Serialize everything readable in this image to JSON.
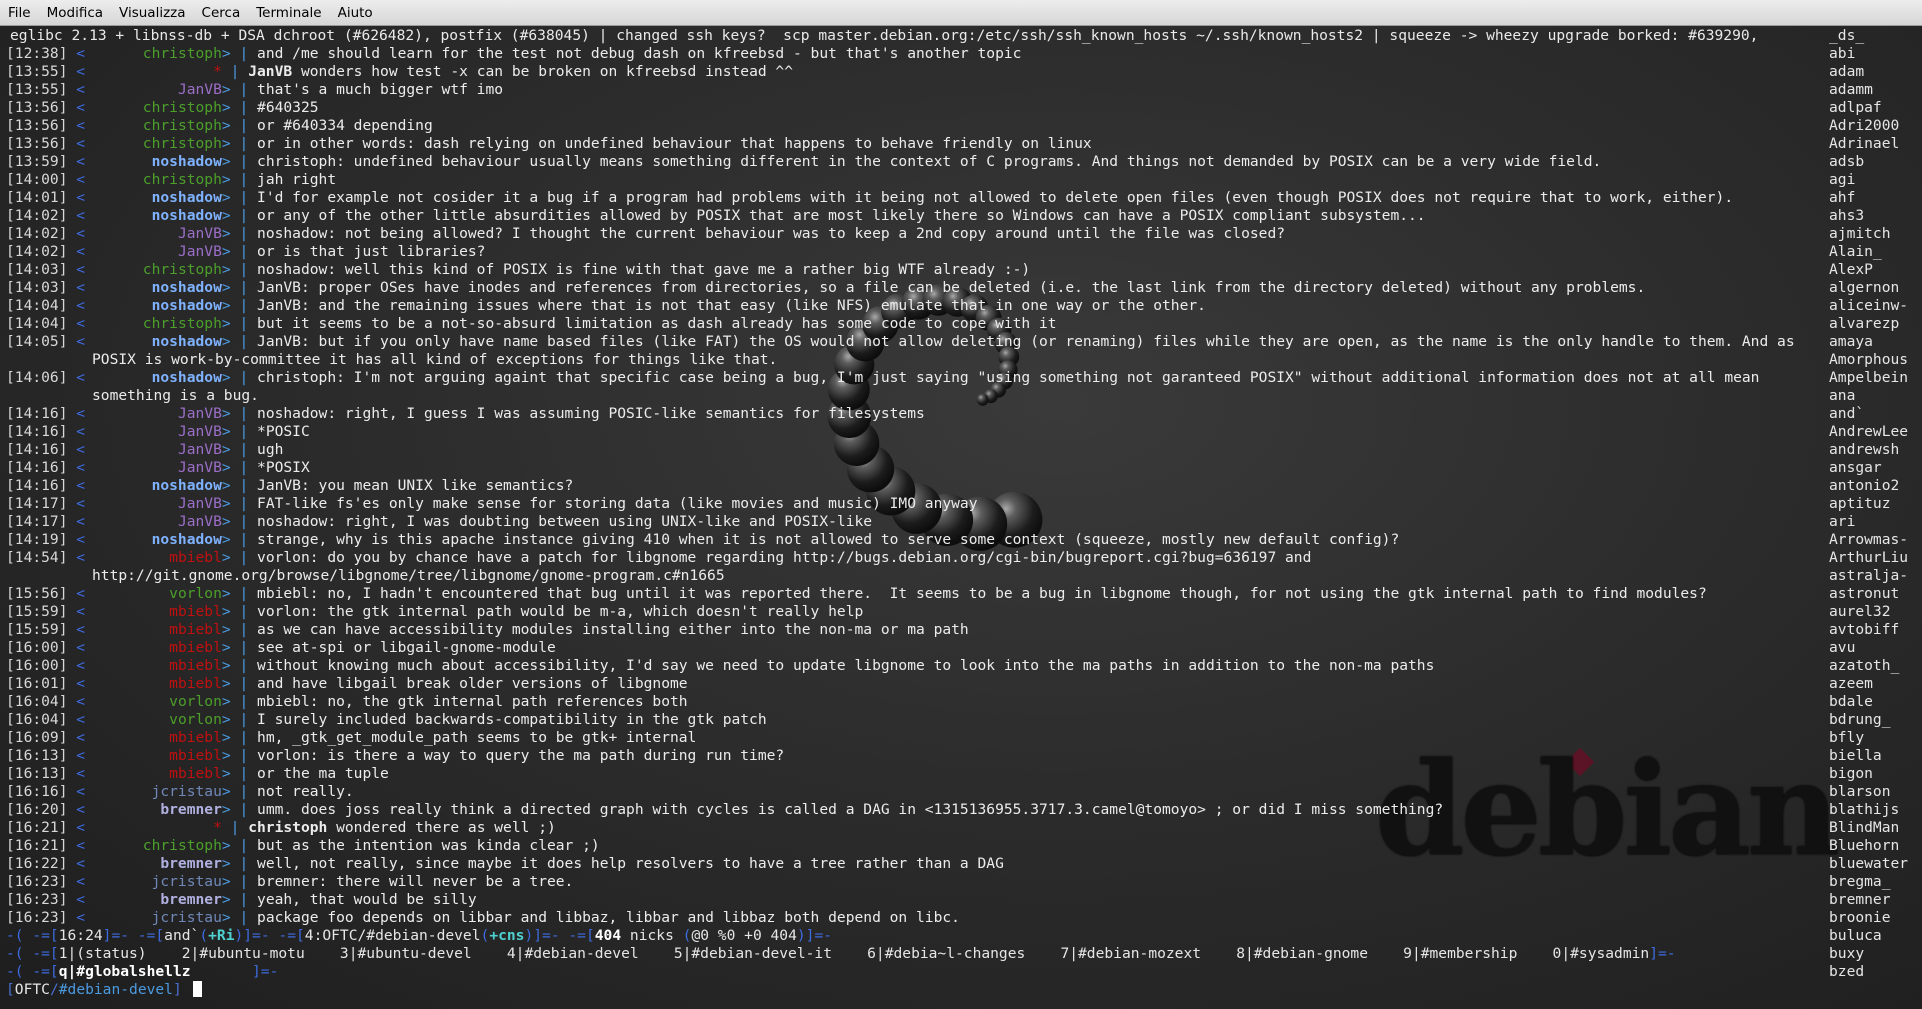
{
  "menu": [
    "File",
    "Modifica",
    "Visualizza",
    "Cerca",
    "Terminale",
    "Aiuto"
  ],
  "topic": "eglibc 2.13 + libnss-db + DSA dchroot (#626482), postfix (#638045) | changed ssh keys?  scp master.debian.org:/etc/ssh/ssh_known_hosts ~/.ssh/known_hosts2 | squeeze -> wheezy upgrade borked: #639290,",
  "logo_text": "debian",
  "messages": [
    {
      "ts": "[12:38]",
      "nick": "christoph",
      "cls": "c-christoph",
      "text": "and /me should learn for the test not debug dash on kfreebsd - but that's another topic"
    },
    {
      "ts": "[13:55]",
      "nick": "*",
      "cls": "c-star",
      "action": true,
      "actor": "JanVB",
      "text": "wonders how test -x can be broken on kfreebsd instead ^^"
    },
    {
      "ts": "[13:55]",
      "nick": "JanVB",
      "cls": "c-JanVB",
      "text": "that's a much bigger wtf imo"
    },
    {
      "ts": "[13:56]",
      "nick": "christoph",
      "cls": "c-christoph",
      "text": "#640325"
    },
    {
      "ts": "[13:56]",
      "nick": "christoph",
      "cls": "c-christoph",
      "text": "or #640334 depending"
    },
    {
      "ts": "[13:56]",
      "nick": "christoph",
      "cls": "c-christoph",
      "text": "or in other words: dash relying on undefined behaviour that happens to behave friendly on linux"
    },
    {
      "ts": "[13:59]",
      "nick": "noshadow",
      "cls": "c-noshadow",
      "text": "christoph: undefined behaviour usually means something different in the context of C programs. And things not demanded by POSIX can be a very wide field."
    },
    {
      "ts": "[14:00]",
      "nick": "christoph",
      "cls": "c-christoph",
      "text": "jah right"
    },
    {
      "ts": "[14:01]",
      "nick": "noshadow",
      "cls": "c-noshadow",
      "text": "I'd for example not cosider it a bug if a program had problems with it being not allowed to delete open files (even though POSIX does not require that to work, either)."
    },
    {
      "ts": "[14:02]",
      "nick": "noshadow",
      "cls": "c-noshadow",
      "text": "or any of the other little absurdities allowed by POSIX that are most likely there so Windows can have a POSIX compliant subsystem..."
    },
    {
      "ts": "[14:02]",
      "nick": "JanVB",
      "cls": "c-JanVB",
      "text": "noshadow: not being allowed? I thought the current behaviour was to keep a 2nd copy around until the file was closed?"
    },
    {
      "ts": "[14:02]",
      "nick": "JanVB",
      "cls": "c-JanVB",
      "text": "or is that just libraries?"
    },
    {
      "ts": "[14:03]",
      "nick": "christoph",
      "cls": "c-christoph",
      "text": "noshadow: well this kind of POSIX is fine with that gave me a rather big WTF already :-)"
    },
    {
      "ts": "[14:03]",
      "nick": "noshadow",
      "cls": "c-noshadow",
      "text": "JanVB: proper OSes have inodes and references from directories, so a file can be deleted (i.e. the last link from the directory deleted) without any problems."
    },
    {
      "ts": "[14:04]",
      "nick": "noshadow",
      "cls": "c-noshadow",
      "text": "JanVB: and the remaining issues where that is not that easy (like NFS) emulate that in one way or the other."
    },
    {
      "ts": "[14:04]",
      "nick": "christoph",
      "cls": "c-christoph",
      "text": "but it seems to be a not-so-absurd limitation as dash already has some code to cope with it"
    },
    {
      "ts": "[14:05]",
      "nick": "noshadow",
      "cls": "c-noshadow",
      "text": "JanVB: but if you only have name based files (like FAT) the OS would not allow deleting (or renaming) files while they are open, as the name is the only handle to them. And as",
      "cont": "POSIX is work-by-committee it has all kind of exceptions for things like that."
    },
    {
      "ts": "[14:06]",
      "nick": "noshadow",
      "cls": "c-noshadow",
      "text": "christoph: I'm not arguing againt that specific case being a bug, I'm just saying \"using something not garanteed POSIX\" without additional information does not at all mean",
      "cont": "something is a bug."
    },
    {
      "ts": "[14:16]",
      "nick": "JanVB",
      "cls": "c-JanVB",
      "text": "noshadow: right, I guess I was assuming POSIC-like semantics for filesystems"
    },
    {
      "ts": "[14:16]",
      "nick": "JanVB",
      "cls": "c-JanVB",
      "text": "*POSIC"
    },
    {
      "ts": "[14:16]",
      "nick": "JanVB",
      "cls": "c-JanVB",
      "text": "ugh"
    },
    {
      "ts": "[14:16]",
      "nick": "JanVB",
      "cls": "c-JanVB",
      "text": "*POSIX"
    },
    {
      "ts": "[14:16]",
      "nick": "noshadow",
      "cls": "c-noshadow",
      "text": "JanVB: you mean UNIX like semantics?"
    },
    {
      "ts": "[14:17]",
      "nick": "JanVB",
      "cls": "c-JanVB",
      "text": "FAT-like fs'es only make sense for storing data (like movies and music) IMO anyway"
    },
    {
      "ts": "[14:17]",
      "nick": "JanVB",
      "cls": "c-JanVB",
      "text": "noshadow: right, I was doubting between using UNIX-like and POSIX-like"
    },
    {
      "ts": "[14:19]",
      "nick": "noshadow",
      "cls": "c-noshadow",
      "text": "strange, why is this apache instance giving 410 when it is not allowed to serve some context (squeeze, mostly new default config)?"
    },
    {
      "ts": "[14:54]",
      "nick": "mbiebl",
      "cls": "c-mbiebl",
      "text": "vorlon: do you by chance have a patch for libgnome regarding http://bugs.debian.org/cgi-bin/bugreport.cgi?bug=636197 and",
      "cont": "http://git.gnome.org/browse/libgnome/tree/libgnome/gnome-program.c#n1665"
    },
    {
      "ts": "[15:56]",
      "nick": "vorlon",
      "cls": "c-vorlon",
      "text": "mbiebl: no, I hadn't encountered that bug until it was reported there.  It seems to be a bug in libgnome though, for not using the gtk internal path to find modules?"
    },
    {
      "ts": "[15:59]",
      "nick": "mbiebl",
      "cls": "c-mbiebl",
      "text": "vorlon: the gtk internal path would be m-a, which doesn't really help"
    },
    {
      "ts": "[15:59]",
      "nick": "mbiebl",
      "cls": "c-mbiebl",
      "text": "as we can have accessibility modules installing either into the non-ma or ma path"
    },
    {
      "ts": "[16:00]",
      "nick": "mbiebl",
      "cls": "c-mbiebl",
      "text": "see at-spi or libgail-gnome-module"
    },
    {
      "ts": "[16:00]",
      "nick": "mbiebl",
      "cls": "c-mbiebl",
      "text": "without knowing much about accessibility, I'd say we need to update libgnome to look into the ma paths in addition to the non-ma paths"
    },
    {
      "ts": "[16:01]",
      "nick": "mbiebl",
      "cls": "c-mbiebl",
      "text": "and have libgail break older versions of libgnome"
    },
    {
      "ts": "[16:04]",
      "nick": "vorlon",
      "cls": "c-vorlon",
      "text": "mbiebl: no, the gtk internal path references both"
    },
    {
      "ts": "[16:04]",
      "nick": "vorlon",
      "cls": "c-vorlon",
      "text": "I surely included backwards-compatibility in the gtk patch"
    },
    {
      "ts": "[16:09]",
      "nick": "mbiebl",
      "cls": "c-mbiebl",
      "text": "hm, _gtk_get_module_path seems to be gtk+ internal"
    },
    {
      "ts": "[16:13]",
      "nick": "mbiebl",
      "cls": "c-mbiebl",
      "text": "vorlon: is there a way to query the ma path during run time?"
    },
    {
      "ts": "[16:13]",
      "nick": "mbiebl",
      "cls": "c-mbiebl",
      "text": "or the ma tuple"
    },
    {
      "ts": "[16:16]",
      "nick": "jcristau",
      "cls": "c-jcristau",
      "text": "not really."
    },
    {
      "ts": "[16:20]",
      "nick": "bremner",
      "cls": "c-bremner",
      "text": "umm. does joss really think a directed graph with cycles is called a DAG in <1315136955.3717.3.camel@tomoyo> ; or did I miss something?"
    },
    {
      "ts": "[16:21]",
      "nick": "*",
      "cls": "c-star",
      "action": true,
      "actor": "christoph",
      "text": "wondered there as well ;)"
    },
    {
      "ts": "[16:21]",
      "nick": "christoph",
      "cls": "c-christoph",
      "text": "but as the intention was kinda clear ;)"
    },
    {
      "ts": "[16:22]",
      "nick": "bremner",
      "cls": "c-bremner",
      "text": "well, not really, since maybe it does help resolvers to have a tree rather than a DAG"
    },
    {
      "ts": "[16:23]",
      "nick": "jcristau",
      "cls": "c-jcristau",
      "text": "bremner: there will never be a tree."
    },
    {
      "ts": "[16:23]",
      "nick": "bremner",
      "cls": "c-bremner",
      "text": "yeah, that would be silly"
    },
    {
      "ts": "[16:23]",
      "nick": "jcristau",
      "cls": "c-jcristau",
      "text": "package foo depends on libbar and libbaz, libbar and libbaz both depend on libc."
    }
  ],
  "nicklist": [
    "_ds_",
    "abi",
    "adam",
    "adamm",
    "adlpaf",
    "Adri2000",
    "Adrinael",
    "adsb",
    "agi",
    "ahf",
    "ahs3",
    "ajmitch",
    "Alain_",
    "AlexP",
    "algernon",
    "aliceinw-",
    "alvarezp",
    "amaya",
    "Amorphous",
    "Ampelbein",
    "ana",
    "and`",
    "AndrewLee",
    "andrewsh",
    "ansgar",
    "antonio2",
    "aptituz",
    "ari",
    "Arrowmas-",
    "ArthurLiu",
    "astralja-",
    "astronut",
    "aurel32",
    "avtobiff",
    "avu",
    "azatoth_",
    "azeem",
    "bdale",
    "bdrung_",
    "bfly",
    "biella",
    "bigon",
    "blarson",
    "blathijs",
    "BlindMan",
    "Bluehorn",
    "bluewater",
    "bregma_",
    "bremner",
    "broonie",
    "buluca",
    "buxy",
    "bzed"
  ],
  "status1": {
    "time": "16:24",
    "nick": "and`",
    "mode": "+Ri",
    "channel": "4:OFTC/#debian-devel",
    "chanmode": "+cns",
    "nickcount": "404",
    "nicks_label": "nicks",
    "counts": "@0 %0 +0 404"
  },
  "status2": {
    "windows": [
      "1|(status)",
      "2|#ubuntu-motu",
      "3|#ubuntu-devel",
      "4|#debian-devel",
      "5|#debian-devel-it",
      "6|#debia~l-changes",
      "7|#debian-mozext",
      "8|#debian-gnome",
      "9|#membership",
      "0|#sysadmin"
    ]
  },
  "status3": {
    "item": "q|#globalshellz"
  },
  "prompt": {
    "network": "OFTC",
    "channel": "#debian-devel"
  }
}
